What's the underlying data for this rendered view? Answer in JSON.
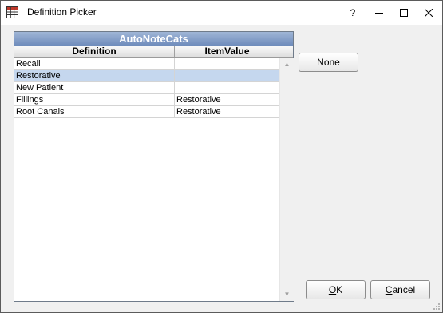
{
  "window": {
    "title": "Definition Picker",
    "help_label": "?",
    "minimize_glyph": "—",
    "maximize_glyph": "☐",
    "close_glyph": "✕"
  },
  "grid": {
    "title": "AutoNoteCats",
    "columns": [
      "Definition",
      "ItemValue"
    ],
    "rows": [
      {
        "definition": "Recall",
        "item_value": ""
      },
      {
        "definition": "Restorative",
        "item_value": ""
      },
      {
        "definition": "New Patient",
        "item_value": ""
      },
      {
        "definition": "Fillings",
        "item_value": "Restorative"
      },
      {
        "definition": "Root Canals",
        "item_value": "Restorative"
      }
    ],
    "selected_row": 1,
    "scroll_up_glyph": "▲",
    "scroll_down_glyph": "▼"
  },
  "buttons": {
    "none_label": "None",
    "ok_label": "OK",
    "ok_mnemonic": "O",
    "ok_rest": "K",
    "cancel_label": "Cancel",
    "cancel_mnemonic": "C",
    "cancel_rest": "ancel"
  },
  "colors": {
    "grid_title_bg": "#7e99c6",
    "selected_row": "#c5d7ee",
    "dialog_bg": "#f0f0f0"
  }
}
